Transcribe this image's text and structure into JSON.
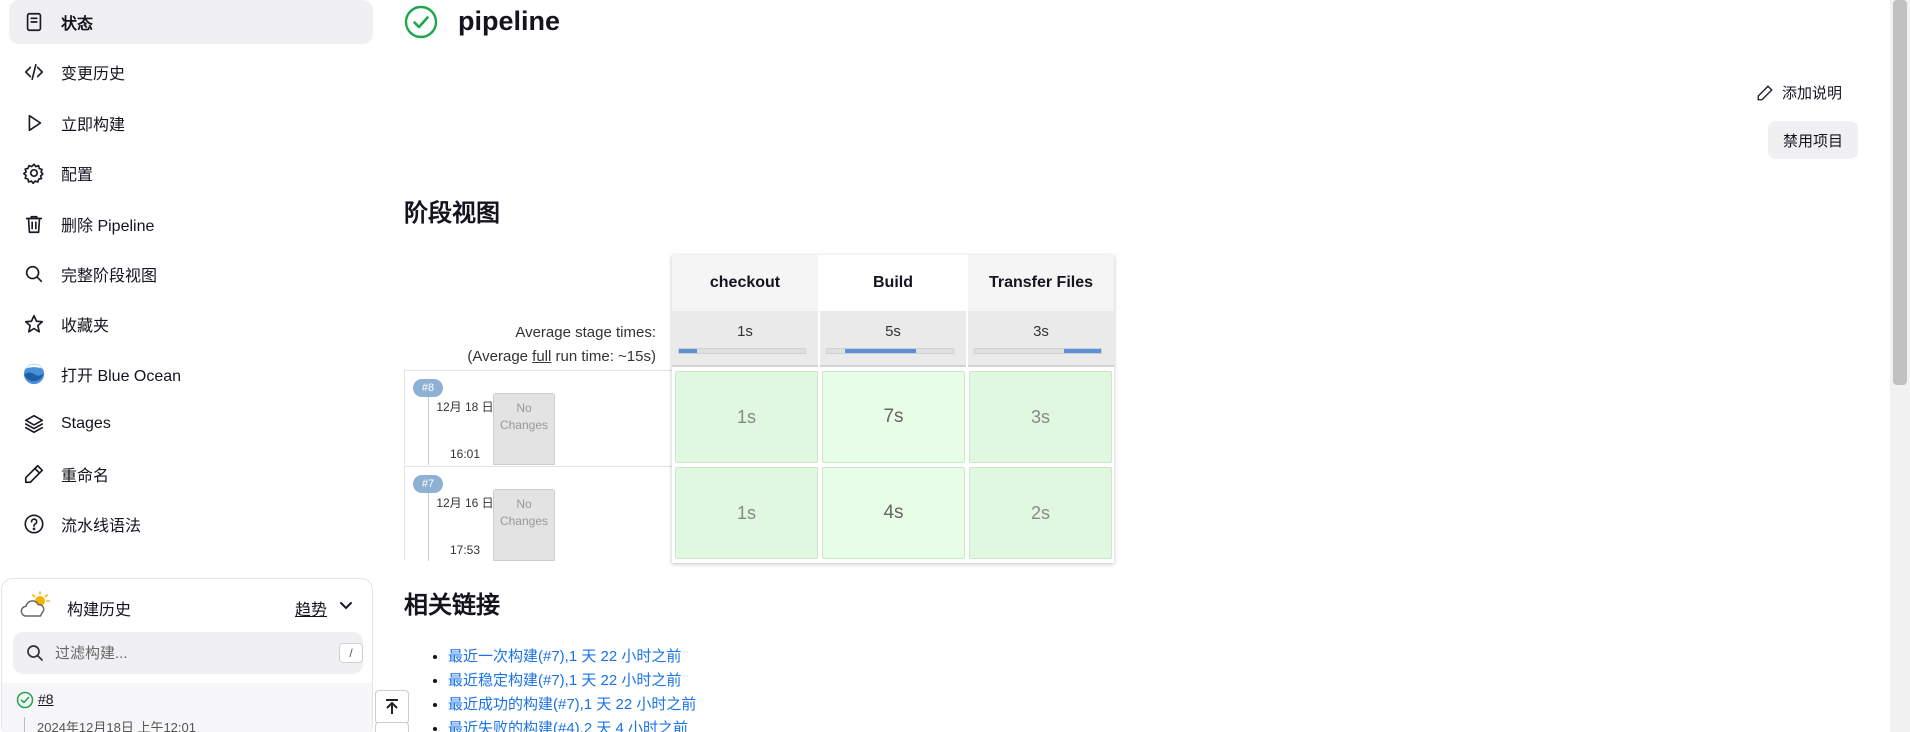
{
  "sidebar": {
    "items": [
      {
        "label": "状态",
        "icon": "status-icon"
      },
      {
        "label": "变更历史",
        "icon": "code-icon"
      },
      {
        "label": "立即构建",
        "icon": "play-icon"
      },
      {
        "label": "配置",
        "icon": "gear-icon"
      },
      {
        "label": "删除 Pipeline",
        "icon": "trash-icon"
      },
      {
        "label": "完整阶段视图",
        "icon": "search-icon"
      },
      {
        "label": "收藏夹",
        "icon": "star-icon"
      },
      {
        "label": "打开 Blue Ocean",
        "icon": "blue-ocean-icon"
      },
      {
        "label": "Stages",
        "icon": "layers-icon"
      },
      {
        "label": "重命名",
        "icon": "pencil-icon"
      },
      {
        "label": "流水线语法",
        "icon": "help-icon"
      }
    ],
    "history": {
      "title": "构建历史",
      "trend": "趋势",
      "search_placeholder": "过滤构建...",
      "shortcut": "/",
      "builds": [
        {
          "number": "#8",
          "date": "2024年12月18日 上午12:01"
        }
      ]
    }
  },
  "page": {
    "title": "pipeline",
    "add_description": "添加说明",
    "disable_button": "禁用项目",
    "stage_view_heading": "阶段视图",
    "related_links_heading": "相关链接"
  },
  "stage_view": {
    "avg_label_line1": "Average stage times:",
    "avg_label_prefix": "(Average ",
    "avg_label_full": "full",
    "avg_label_suffix": " run time: ~15s)",
    "stages": [
      {
        "name": "checkout",
        "avg": "1s",
        "avg_fraction_start": 0.0,
        "avg_fraction_width": 0.14
      },
      {
        "name": "Build",
        "avg": "5s",
        "avg_fraction_start": 0.14,
        "avg_fraction_width": 0.57
      },
      {
        "name": "Transfer Files",
        "avg": "3s",
        "avg_fraction_start": 0.71,
        "avg_fraction_width": 0.29
      }
    ],
    "runs": [
      {
        "badge": "#8",
        "date": "12月 18 日",
        "time": "16:01",
        "changes": "No Changes",
        "durations": [
          "1s",
          "7s",
          "3s"
        ]
      },
      {
        "badge": "#7",
        "date": "12月 16 日",
        "time": "17:53",
        "changes": "No Changes",
        "durations": [
          "1s",
          "4s",
          "2s"
        ]
      }
    ]
  },
  "related_links": [
    "最近一次构建(#7),1 天 22 小时之前",
    "最近稳定构建(#7),1 天 22 小时之前",
    "最近成功的构建(#7),1 天 22 小时之前",
    "最近失败的构建(#4),2 天 4 小时之前"
  ],
  "colors": {
    "success": "#1ea64b",
    "link": "#1a73e8",
    "stage_cell": "#e0f7e0",
    "progress": "#5b8fd6"
  }
}
